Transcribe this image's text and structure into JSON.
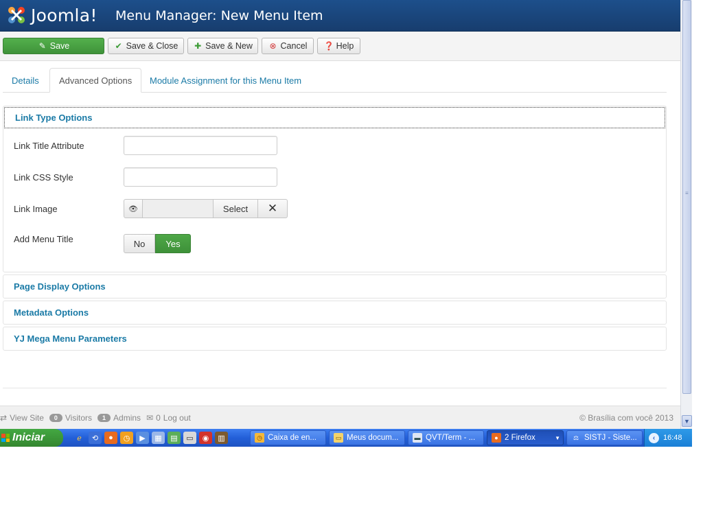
{
  "app": {
    "logo_text": "Joomla!",
    "page_title": "Menu Manager: New Menu Item"
  },
  "toolbar": {
    "save": "Save",
    "save_close": "Save & Close",
    "save_new": "Save & New",
    "cancel": "Cancel",
    "help": "Help"
  },
  "tabs": [
    {
      "label": "Details",
      "active": false
    },
    {
      "label": "Advanced Options",
      "active": true
    },
    {
      "label": "Module Assignment for this Menu Item",
      "active": false
    }
  ],
  "panels": {
    "link_type": {
      "title": "Link Type Options",
      "fields": {
        "link_title_attribute": {
          "label": "Link Title Attribute",
          "value": ""
        },
        "link_css_style": {
          "label": "Link CSS Style",
          "value": ""
        },
        "link_image": {
          "label": "Link Image",
          "value": "",
          "select_label": "Select",
          "clear_label": "✕"
        },
        "add_menu_title": {
          "label": "Add Menu Title",
          "options": [
            "No",
            "Yes"
          ],
          "selected": "Yes"
        }
      }
    },
    "page_display": {
      "title": "Page Display Options"
    },
    "metadata": {
      "title": "Metadata Options"
    },
    "yj_mega_menu": {
      "title": "YJ Mega Menu Parameters"
    }
  },
  "status": {
    "view_site": "View Site",
    "visitors_count": "0",
    "visitors_label": "Visitors",
    "admins_count": "1",
    "admins_label": "Admins",
    "messages_count": "0",
    "logout": "Log out",
    "copyright": "© Brasília com você 2013"
  },
  "taskbar": {
    "start_label": "Iniciar",
    "tasks": [
      {
        "label": "Caixa de en...",
        "active": false
      },
      {
        "label": "Meus docum...",
        "active": false
      },
      {
        "label": "QVT/Term - ...",
        "active": false
      },
      {
        "label": "2 Firefox",
        "active": true
      },
      {
        "label": "SISTJ - Siste...",
        "active": false
      }
    ],
    "clock": "16:48"
  },
  "colors": {
    "header_bg": "#1d4f8b",
    "save_green": "#46a040",
    "link_blue": "#1a7aa6",
    "taskbar_blue": "#245edb",
    "start_green": "#3c9a39"
  }
}
